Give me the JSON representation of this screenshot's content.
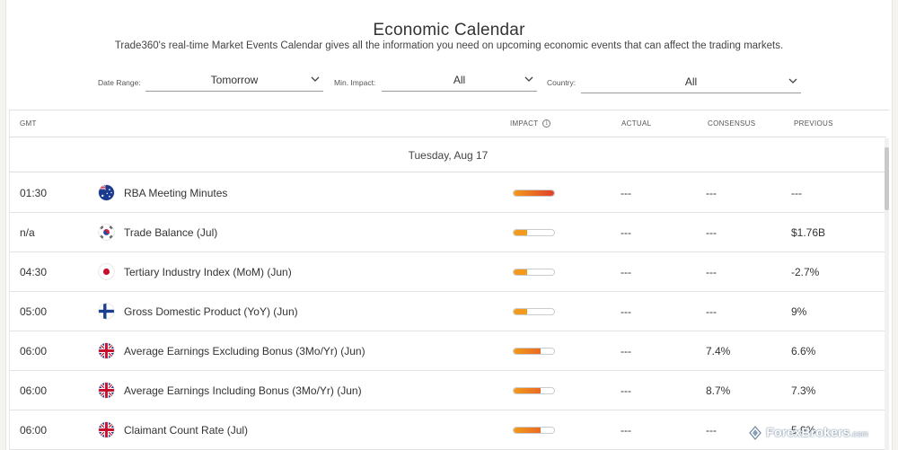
{
  "header": {
    "title": "Economic Calendar",
    "subtitle": "Trade360's real-time Market Events Calendar gives all the information you need on upcoming economic events that can affect the trading markets."
  },
  "filters": {
    "date_range": {
      "label": "Date Range:",
      "value": "Tomorrow"
    },
    "min_impact": {
      "label": "Min. Impact:",
      "value": "All"
    },
    "country": {
      "label": "Country:",
      "value": "All"
    }
  },
  "table": {
    "headers": {
      "gmt": "GMT",
      "impact": "IMPACT",
      "actual": "ACTUAL",
      "consensus": "CONSENSUS",
      "previous": "PREVIOUS"
    },
    "date_group": "Tuesday, Aug 17",
    "rows": [
      {
        "time": "01:30",
        "flag": "australia-flag-icon",
        "event": "RBA Meeting Minutes",
        "impact_level": 1.0,
        "actual": "---",
        "consensus": "---",
        "previous": "---"
      },
      {
        "time": "n/a",
        "flag": "south-korea-flag-icon",
        "event": "Trade Balance (Jul)",
        "impact_level": 0.33,
        "actual": "---",
        "consensus": "---",
        "previous": "$1.76B"
      },
      {
        "time": "04:30",
        "flag": "japan-flag-icon",
        "event": "Tertiary Industry Index (MoM) (Jun)",
        "impact_level": 0.33,
        "actual": "---",
        "consensus": "---",
        "previous": "-2.7%"
      },
      {
        "time": "05:00",
        "flag": "finland-flag-icon",
        "event": "Gross Domestic Product (YoY) (Jun)",
        "impact_level": 0.33,
        "actual": "---",
        "consensus": "---",
        "previous": "9%"
      },
      {
        "time": "06:00",
        "flag": "uk-flag-icon",
        "event": "Average Earnings Excluding Bonus (3Mo/Yr) (Jun)",
        "impact_level": 0.66,
        "actual": "---",
        "consensus": "7.4%",
        "previous": "6.6%"
      },
      {
        "time": "06:00",
        "flag": "uk-flag-icon",
        "event": "Average Earnings Including Bonus (3Mo/Yr) (Jun)",
        "impact_level": 0.66,
        "actual": "---",
        "consensus": "8.7%",
        "previous": "7.3%"
      },
      {
        "time": "06:00",
        "flag": "uk-flag-icon",
        "event": "Claimant Count Rate (Jul)",
        "impact_level": 0.66,
        "actual": "---",
        "consensus": "---",
        "previous": "5.9%"
      }
    ]
  },
  "colors": {
    "impact_low": "#f29a1c",
    "impact_high": "#e0402a"
  },
  "watermark": {
    "text": "ForexBrokers",
    "suffix": ".com"
  }
}
